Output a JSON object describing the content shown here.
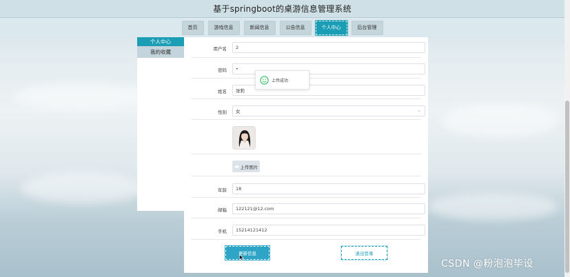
{
  "app": {
    "title": "基于springboot的桌游信息管理系统"
  },
  "nav": {
    "items": [
      {
        "label": "首页",
        "active": false
      },
      {
        "label": "游戏信息",
        "active": false
      },
      {
        "label": "新闻信息",
        "active": false
      },
      {
        "label": "公告信息",
        "active": false
      },
      {
        "label": "个人中心",
        "active": true
      },
      {
        "label": "后台管理",
        "active": false
      }
    ]
  },
  "sidebar": {
    "items": [
      {
        "label": "个人中心",
        "active": true
      },
      {
        "label": "我的收藏",
        "active": false
      }
    ]
  },
  "form": {
    "username": {
      "label": "用户名",
      "value": "2"
    },
    "password": {
      "label": "密码",
      "value": "•"
    },
    "name": {
      "label": "姓名",
      "value": "张莉"
    },
    "gender": {
      "label": "性别",
      "value": "女"
    },
    "upload_label": "上传图片",
    "age": {
      "label": "年龄",
      "value": "18"
    },
    "email": {
      "label": "邮箱",
      "value": "122121@12.com"
    },
    "phone": {
      "label": "手机",
      "value": "15214121412"
    },
    "update_button": "更新信息",
    "logout_button": "退出登录"
  },
  "toast": {
    "message": "上传成功"
  },
  "watermark": {
    "text": "CSDN @粉泡泡毕设"
  },
  "colors": {
    "accent": "#1a9db5",
    "toast_icon": "#3fbf6a"
  },
  "icons": {
    "toast": "smile-icon",
    "upload": "cloud-upload-icon",
    "select": "chevron-down-icon"
  }
}
